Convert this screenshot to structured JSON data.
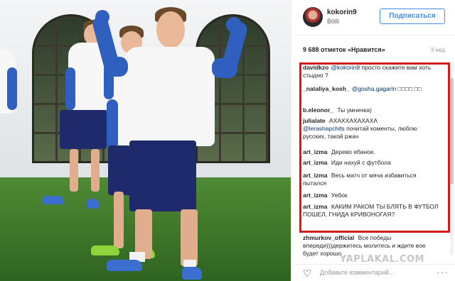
{
  "post": {
    "username": "kokorin9",
    "location": "Bölli",
    "follow_label": "Подписаться",
    "likes": "9 688 отметок «Нравится»",
    "time_ago": "3 нед."
  },
  "comments": [
    {
      "author": "davidkzo",
      "mention": "@kokorin9",
      "text": "просто скажите вам хоть стыдно ?"
    },
    {
      "author": "_nataliya_kosh_",
      "mention": "@gosha.gagarin",
      "text": "□□□□ □□"
    },
    {
      "author": "b.eleonor_",
      "mention": "",
      "text": "Ты умничка)"
    },
    {
      "author": "julialate",
      "mention": "",
      "text": "АХАХХАХАХАХА",
      "mention2": "@lerashapchits",
      "text2": "почитай коменты, люблю русских, такой ржач"
    },
    {
      "author": "art_izma",
      "mention": "",
      "text": "Дерево ебаное."
    },
    {
      "author": "art_izma",
      "mention": "",
      "text": "Иди нахуй с футбола"
    },
    {
      "author": "art_izma",
      "mention": "",
      "text": "Весь матч от мяча избавиться пытался"
    },
    {
      "author": "art_izma",
      "mention": "",
      "text": "Уебок"
    },
    {
      "author": "art_izma",
      "mention": "",
      "text": "КАКИМ РАКОМ ТЫ БЛЯТЬ В ФУТБОЛ ПОШЕЛ, ГНИДА КРИВОНОГАЯ?"
    },
    {
      "author": "zhmurkov_official",
      "mention": "",
      "text": "Все победы впереди)))держитесь молитесь и ждите вое будет хорошо"
    }
  ],
  "footer": {
    "add_comment_placeholder": "Добавьте комментарий...",
    "heart_icon": "heart-icon",
    "more_icon": "more-dots-icon"
  },
  "watermark": "YAPLAKAL.COM",
  "colors": {
    "highlight": "#d01c1c",
    "follow_blue": "#3f8ce8",
    "mention_blue": "#003569"
  }
}
